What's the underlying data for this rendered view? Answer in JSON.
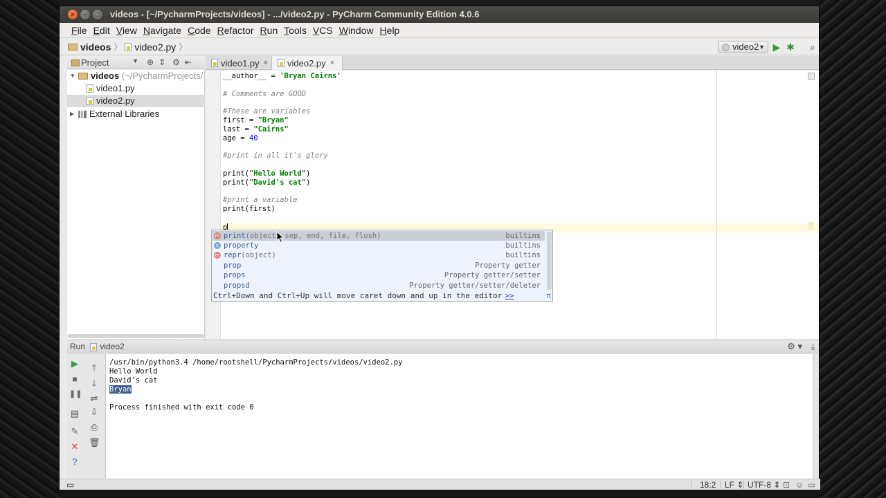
{
  "window": {
    "title": "videos - [~/PycharmProjects/videos] - .../video2.py - PyCharm Community Edition 4.0.6"
  },
  "menu": [
    {
      "label": "File",
      "mnemonic": "F",
      "rest": "ile"
    },
    {
      "label": "Edit",
      "mnemonic": "E",
      "rest": "dit"
    },
    {
      "label": "View",
      "mnemonic": "V",
      "rest": "iew"
    },
    {
      "label": "Navigate",
      "mnemonic": "N",
      "rest": "avigate"
    },
    {
      "label": "Code",
      "mnemonic": "C",
      "rest": "ode"
    },
    {
      "label": "Refactor",
      "mnemonic": "R",
      "rest": "efactor"
    },
    {
      "label": "Run",
      "mnemonic": "R",
      "rest": "un"
    },
    {
      "label": "Tools",
      "mnemonic": "T",
      "rest": "ools"
    },
    {
      "label": "VCS",
      "mnemonic": "V",
      "rest": "CS"
    },
    {
      "label": "Window",
      "mnemonic": "W",
      "rest": "indow"
    },
    {
      "label": "Help",
      "mnemonic": "H",
      "rest": "elp"
    }
  ],
  "navbar": {
    "crumb_project": "videos",
    "crumb_file": "video2.py",
    "run_config": "video2"
  },
  "project": {
    "view_label": "Project",
    "root_name": "videos",
    "root_path": "(~/PycharmProjects/",
    "files": [
      "video1.py",
      "video2.py"
    ],
    "external": "External Libraries"
  },
  "tabs": [
    {
      "label": "video1.py",
      "active": false
    },
    {
      "label": "video2.py",
      "active": true
    }
  ],
  "code": {
    "l0_a": "__author__ = ",
    "l0_b": "'Bryan Cairns'",
    "l2": "# Comments are GOOD",
    "l4": "#These are variables",
    "l5_a": "first = ",
    "l5_b": "\"Bryan\"",
    "l6_a": "last = ",
    "l6_b": "\"Cairns\"",
    "l7_a": "age = ",
    "l7_b": "40",
    "l9": "#print in all it's glory",
    "l11_a": "print(",
    "l11_b": "\"Hello World\"",
    "l11_c": ")",
    "l12_a": "print(",
    "l12_b": "\"David's cat\"",
    "l12_c": ")",
    "l14": "#print a variable",
    "l15": "print(first)",
    "l17": "p"
  },
  "completion": {
    "items": [
      {
        "badge": "m",
        "name": "print",
        "args": "(object, sep, end, file, flush)",
        "source": "builtins"
      },
      {
        "badge": "c",
        "name": "property",
        "args": "",
        "source": "builtins"
      },
      {
        "badge": "m",
        "name": "repr",
        "args": "(object)",
        "source": "builtins"
      },
      {
        "badge": "",
        "name": "prop",
        "args": "",
        "source": "Property getter"
      },
      {
        "badge": "",
        "name": "props",
        "args": "",
        "source": "Property getter/setter"
      },
      {
        "badge": "",
        "name": "propsd",
        "args": "",
        "source": "Property getter/setter/deleter"
      }
    ],
    "hint": "Ctrl+Down and Ctrl+Up will move caret down and up in the editor",
    "hint_link": ">>",
    "pi": "π"
  },
  "run": {
    "label": "Run",
    "config": "video2",
    "lines": [
      "/usr/bin/python3.4 /home/rootshell/PycharmProjects/videos/video2.py",
      "Hello World",
      "David's cat",
      "Bryan",
      "",
      "Process finished with exit code 0"
    ]
  },
  "status": {
    "position": "18:2",
    "line_sep": "LF",
    "encoding": "UTF-8"
  },
  "colors": {
    "string": "#008000",
    "number": "#0000ff",
    "comment": "#808080",
    "selection": "#3d5b8c"
  }
}
